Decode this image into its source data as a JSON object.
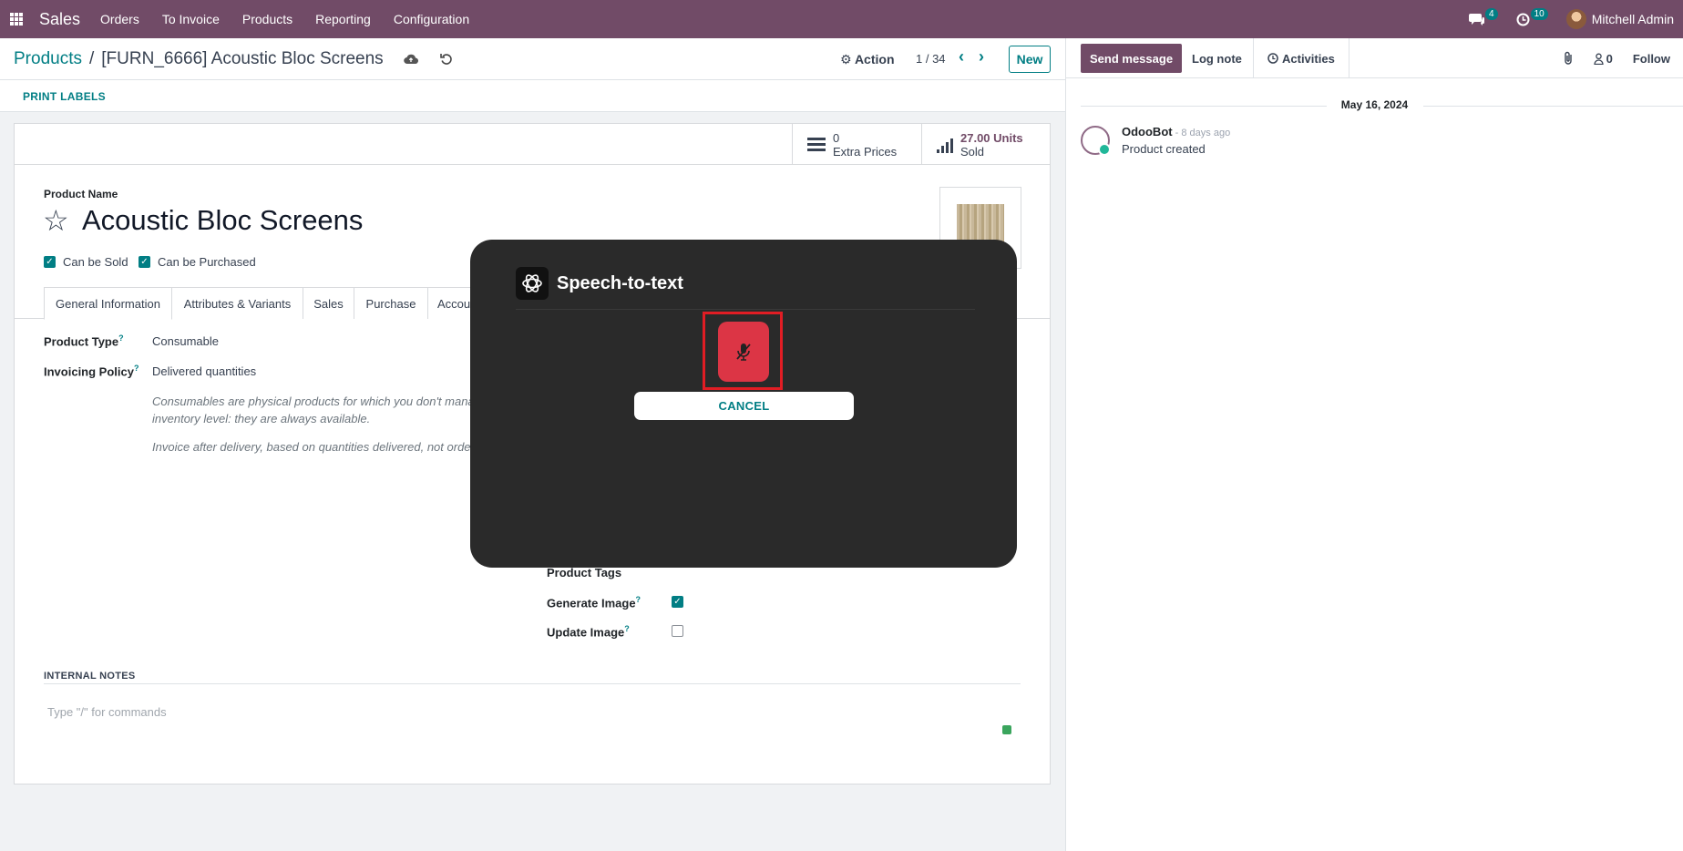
{
  "navbar": {
    "app_name": "Sales",
    "menu": [
      "Orders",
      "To Invoice",
      "Products",
      "Reporting",
      "Configuration"
    ],
    "messages_count": "4",
    "activities_count": "10",
    "user_name": "Mitchell Admin"
  },
  "control_panel": {
    "breadcrumb_parent": "Products",
    "breadcrumb_separator": "/",
    "breadcrumb_current": "[FURN_6666] Acoustic Bloc Screens",
    "action_label": "Action",
    "pager": "1 / 34",
    "new_label": "New",
    "print_labels": "PRINT LABELS"
  },
  "stat_buttons": {
    "extra_prices_value": "0",
    "extra_prices_label": "Extra Prices",
    "sold_value": "27.00 Units",
    "sold_label": "Sold"
  },
  "form": {
    "product_name_label": "Product Name",
    "product_name": "Acoustic Bloc Screens",
    "can_be_sold": "Can be Sold",
    "can_be_purchased": "Can be Purchased",
    "tabs": [
      "General Information",
      "Attributes & Variants",
      "Sales",
      "Purchase",
      "Accou"
    ],
    "product_type_label": "Product Type",
    "product_type_value": "Consumable",
    "invoicing_policy_label": "Invoicing Policy",
    "invoicing_policy_value": "Delivered quantities",
    "help_consumable_line1": "Consumables are physical products for which you don't mana",
    "help_consumable_line2": "inventory level: they are always available.",
    "help_invoice": "Invoice after delivery, based on quantities delivered, not order",
    "product_tags_label": "Product Tags",
    "generate_image_label": "Generate Image",
    "update_image_label": "Update Image",
    "internal_notes_label": "INTERNAL NOTES",
    "notes_placeholder": "Type \"/\" for commands"
  },
  "chatter": {
    "send_message": "Send message",
    "log_note": "Log note",
    "activities": "Activities",
    "followers_count": "0",
    "follow": "Follow",
    "date": "May 16, 2024",
    "author": "OdooBot",
    "time": " - 8 days ago",
    "message": "Product created"
  },
  "modal": {
    "title": "Speech-to-text",
    "cancel": "CANCEL"
  },
  "colors": {
    "brand": "#714b67",
    "accent": "#017e84",
    "modal_bg": "#2a2a2a",
    "mic_red": "#dc3545",
    "highlight": "#e11d24"
  }
}
